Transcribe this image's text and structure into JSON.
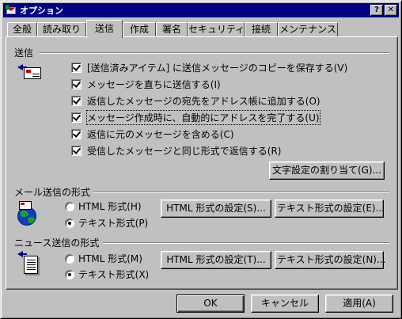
{
  "window": {
    "title": "オプション",
    "help": "?",
    "close": "✕"
  },
  "tabs": [
    "全般",
    "読み取り",
    "送信",
    "作成",
    "署名",
    "セキュリティ",
    "接続",
    "メンテナンス"
  ],
  "send_group": {
    "label": "送信",
    "options": [
      {
        "label": "[送信済みアイテム] に送信メッセージのコピーを保存する(V)",
        "checked": true
      },
      {
        "label": "メッセージを直ちに送信する(I)",
        "checked": true
      },
      {
        "label": "返信したメッセージの宛先をアドレス帳に追加する(O)",
        "checked": true
      },
      {
        "label": "メッセージ作成時に、自動的にアドレスを完了する(U)",
        "checked": true
      },
      {
        "label": "返信に元のメッセージを含める(C)",
        "checked": true
      },
      {
        "label": "受信したメッセージと同じ形式で返信する(R)",
        "checked": true
      }
    ],
    "charset_button": "文字設定の割り当て(G)..."
  },
  "mail_format": {
    "label": "メール送信の形式",
    "html_option": "HTML 形式(H)",
    "text_option": "テキスト形式(P)",
    "selected": "text",
    "html_settings": "HTML 形式の設定(S)...",
    "text_settings": "テキスト形式の設定(E)..."
  },
  "news_format": {
    "label": "ニュース送信の形式",
    "html_option": "HTML 形式(M)",
    "text_option": "テキスト形式(X)",
    "selected": "text",
    "html_settings": "HTML 形式の設定(T)...",
    "text_settings": "テキスト形式の設定(N)..."
  },
  "footer": {
    "ok": "OK",
    "cancel": "キャンセル",
    "apply": "適用(A)"
  }
}
